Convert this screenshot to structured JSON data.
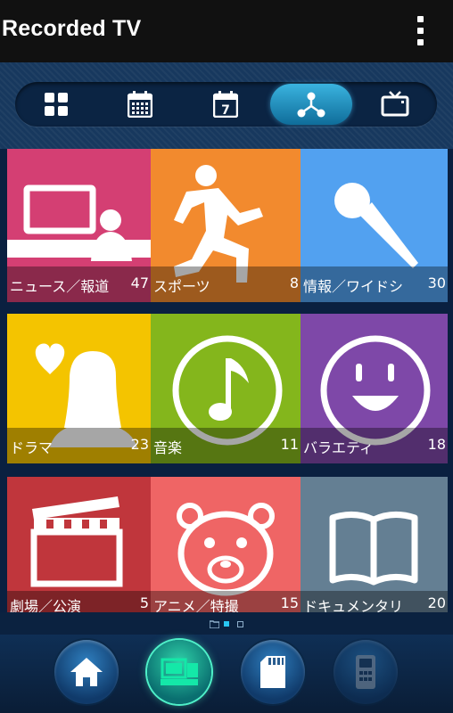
{
  "header": {
    "title": "Recorded TV",
    "menu_icon": "overflow-menu-icon"
  },
  "tabs": [
    {
      "icon": "grid-icon",
      "active": false
    },
    {
      "icon": "calendar-icon",
      "active": false
    },
    {
      "icon": "calendar-day-icon",
      "text": "7",
      "active": false
    },
    {
      "icon": "genre-network-icon",
      "active": true
    },
    {
      "icon": "tv-icon",
      "active": false
    }
  ],
  "genres": [
    {
      "label": "ニュース／報道",
      "count": "47",
      "color": "#d43f73",
      "icon": "news-anchor-icon"
    },
    {
      "label": "スポーツ",
      "count": "8",
      "color": "#f28a2e",
      "icon": "runner-icon"
    },
    {
      "label": "情報／ワイドシ",
      "count": "30",
      "color": "#52a1f0",
      "icon": "microphone-icon"
    },
    {
      "label": "ドラマ",
      "count": "23",
      "color": "#f4c400",
      "icon": "drama-person-heart-icon"
    },
    {
      "label": "音楽",
      "count": "11",
      "color": "#84b61c",
      "icon": "music-note-icon"
    },
    {
      "label": "バラエティ",
      "count": "18",
      "color": "#7e48a8",
      "icon": "smiley-icon"
    },
    {
      "label": "劇場／公演",
      "count": "5",
      "color": "#c0363c",
      "icon": "clapperboard-icon"
    },
    {
      "label": "アニメ／特撮",
      "count": "15",
      "color": "#ef6565",
      "icon": "bear-icon"
    },
    {
      "label": "ドキュメンタリ",
      "count": "20",
      "color": "#647f93",
      "icon": "open-book-icon"
    }
  ],
  "pager": {
    "pages": 2,
    "current": 1
  },
  "bottom_nav": [
    {
      "icon": "home-icon",
      "active": false
    },
    {
      "icon": "recorder-icon",
      "active": true
    },
    {
      "icon": "sd-card-icon",
      "active": false
    },
    {
      "icon": "remote-control-icon",
      "active": false,
      "disabled": true
    }
  ],
  "colors": {
    "accent": "#3ab3df",
    "active_nav": "#2fd1a8"
  }
}
